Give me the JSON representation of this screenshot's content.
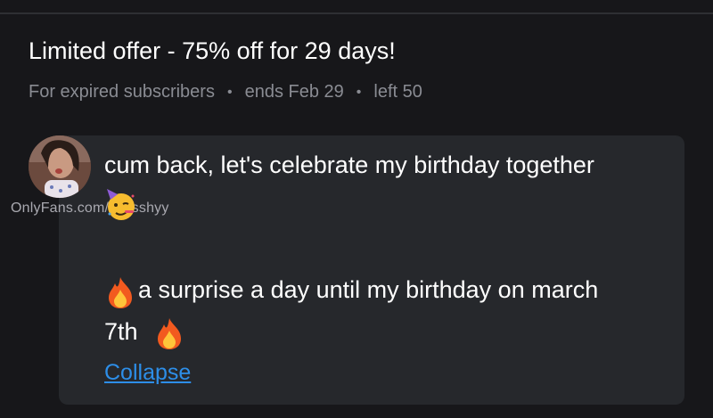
{
  "offer": {
    "title": "Limited offer - 75% off for 29 days!",
    "audience": "For expired subscribers",
    "ends": "ends Feb 29",
    "left": "left 50",
    "separator": "•"
  },
  "post": {
    "watermark": "OnlyFans.com/cassshyy",
    "line1": "cum back, let's celebrate my birthday together",
    "line2": "a surprise a day until my birthday on march",
    "line3": "7th",
    "collapse_label": "Collapse",
    "emojis": [
      "partying-face-icon",
      "fire-icon",
      "fire-icon"
    ]
  },
  "colors": {
    "background": "#17171a",
    "bubble": "#26282c",
    "link": "#2d8ee8",
    "meta_text": "#8a8c93"
  }
}
